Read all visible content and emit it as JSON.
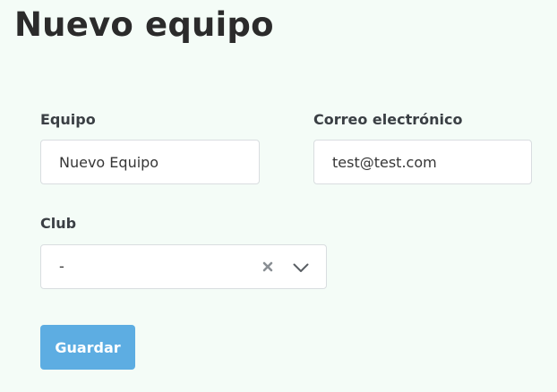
{
  "page": {
    "title": "Nuevo equipo"
  },
  "form": {
    "team": {
      "label": "Equipo",
      "value": "Nuevo Equipo"
    },
    "email": {
      "label": "Correo electrónico",
      "value": "test@test.com"
    },
    "club": {
      "label": "Club",
      "selected": "-"
    },
    "submit_label": "Guardar"
  },
  "icons": {
    "clear": "clear-x-icon",
    "dropdown": "chevron-down-icon"
  },
  "colors": {
    "background": "#f4fcf7",
    "accent": "#5dade2"
  }
}
